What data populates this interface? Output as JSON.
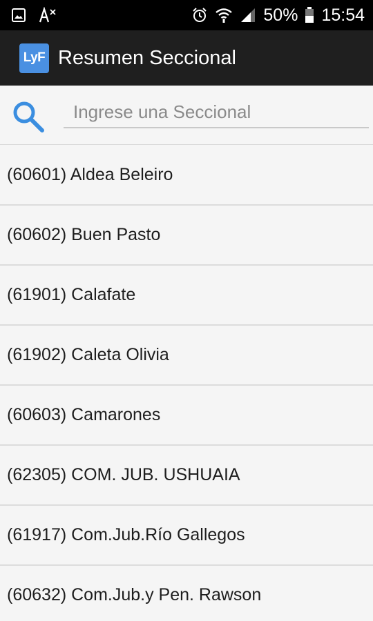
{
  "status_bar": {
    "icons_left": [
      "image-icon",
      "translate-icon"
    ],
    "icons_right": [
      "alarm-icon",
      "wifi-icon",
      "signal-icon"
    ],
    "battery": "50%",
    "time": "15:54"
  },
  "app_bar": {
    "logo_text": "LyF",
    "title": "Resumen Seccional"
  },
  "search": {
    "placeholder": "Ingrese una Seccional",
    "value": ""
  },
  "list": {
    "items": [
      {
        "label": "(60601) Aldea Beleiro"
      },
      {
        "label": "(60602) Buen Pasto"
      },
      {
        "label": "(61901) Calafate"
      },
      {
        "label": "(61902) Caleta Olivia"
      },
      {
        "label": "(60603) Camarones"
      },
      {
        "label": "(62305) COM. JUB. USHUAIA"
      },
      {
        "label": "(61917) Com.Jub.Río Gallegos"
      },
      {
        "label": "(60632) Com.Jub.y Pen. Rawson"
      }
    ]
  },
  "colors": {
    "status_bar": "#000000",
    "app_bar": "#1f1f1f",
    "logo": "#4a90e2",
    "search_icon": "#3b8ee0",
    "background": "#f5f5f5"
  }
}
